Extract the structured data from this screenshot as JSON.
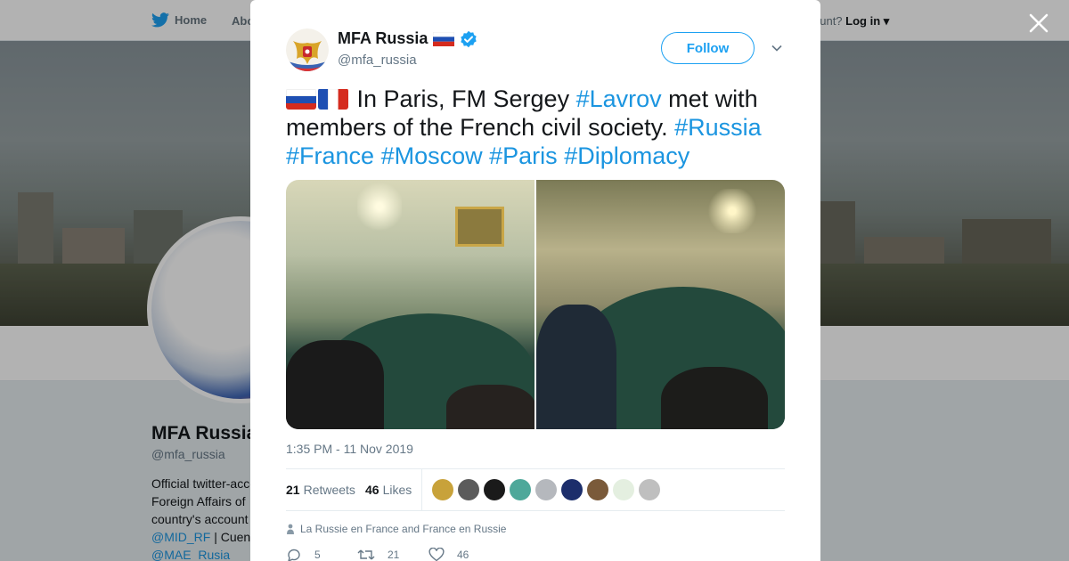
{
  "nav": {
    "home_label": "Home",
    "about_label": "Abo",
    "account_prompt": "ccount?",
    "login_label": "Log in"
  },
  "profile": {
    "name": "MFA Russia",
    "handle": "@mfa_russia",
    "bio_lines": [
      "Official twitter-acco",
      "Foreign Affairs of",
      "country's account"
    ],
    "bio_link1": "@MID_RF",
    "bio_link1_suffix": " | Cuen",
    "bio_link2": "@MAE_Rusia"
  },
  "tweet": {
    "display_name": "MFA Russia",
    "handle": "@mfa_russia",
    "follow_label": "Follow",
    "text_parts": {
      "t1": " In Paris, FM Sergey ",
      "h1": "#Lavrov",
      "t2": " met with members of the French civil society. ",
      "h2": "#Russia",
      "h3": "#France",
      "h4": "#Moscow",
      "h5": "#Paris",
      "h6": "#Diplomacy"
    },
    "timestamp": "1:35 PM - 11 Nov 2019",
    "retweets_count": "21",
    "retweets_label": "Retweets",
    "likes_count": "46",
    "likes_label": "Likes",
    "context": "La Russie en France and France en Russie",
    "actions": {
      "reply_count": "5",
      "retweet_count": "21",
      "like_count": "46"
    }
  },
  "colors": {
    "link": "#1b95e0",
    "follow": "#1da1f2",
    "verified": "#1da1f2"
  },
  "liker_colors": [
    "#c8a23a",
    "#5b5b5b",
    "#1a1a1a",
    "#4ea89a",
    "#b5b8bd",
    "#1c2e6b",
    "#7a5a3a",
    "#e4efe0",
    "#bfbfbf"
  ]
}
